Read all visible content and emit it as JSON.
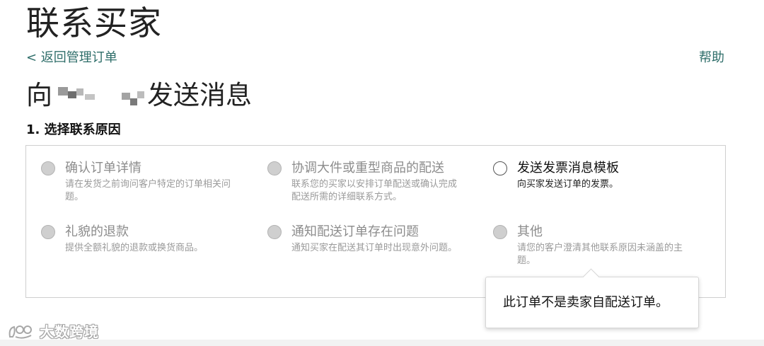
{
  "header": {
    "title": "联系买家",
    "back_link": "< 返回管理订单",
    "help_link": "帮助"
  },
  "message": {
    "prefix": "向",
    "suffix": "发送消息"
  },
  "section": {
    "label": "1. 选择联系原因"
  },
  "reasons": [
    {
      "title": "确认订单详情",
      "description": "请在发货之前询问客户特定的订单相关问题。",
      "enabled": false
    },
    {
      "title": "协调大件或重型商品的配送",
      "description": "联系您的买家以安排订单配送或确认完成配送所需的详细联系方式。",
      "enabled": false
    },
    {
      "title": "发送发票消息模板",
      "description": "向买家发送订单的发票。",
      "enabled": true
    },
    {
      "title": "礼貌的退款",
      "description": "提供全额礼貌的退款或换货商品。",
      "enabled": false
    },
    {
      "title": "通知配送订单存在问题",
      "description": "通知买家在配送其订单时出现意外问题。",
      "enabled": false
    },
    {
      "title": "其他",
      "description": "请您的客户澄清其他联系原因未涵盖的主题。",
      "enabled": false
    }
  ],
  "tooltip": {
    "text": "此订单不是卖家自配送订单。"
  },
  "watermark": {
    "text": "大数跨境",
    "icon": "brand-logo-icon"
  },
  "colors": {
    "link": "#2f6e6a",
    "disabled_text": "#8c8c8c",
    "radio_disabled": "#cfcfcf",
    "border": "#cfcfcf"
  }
}
